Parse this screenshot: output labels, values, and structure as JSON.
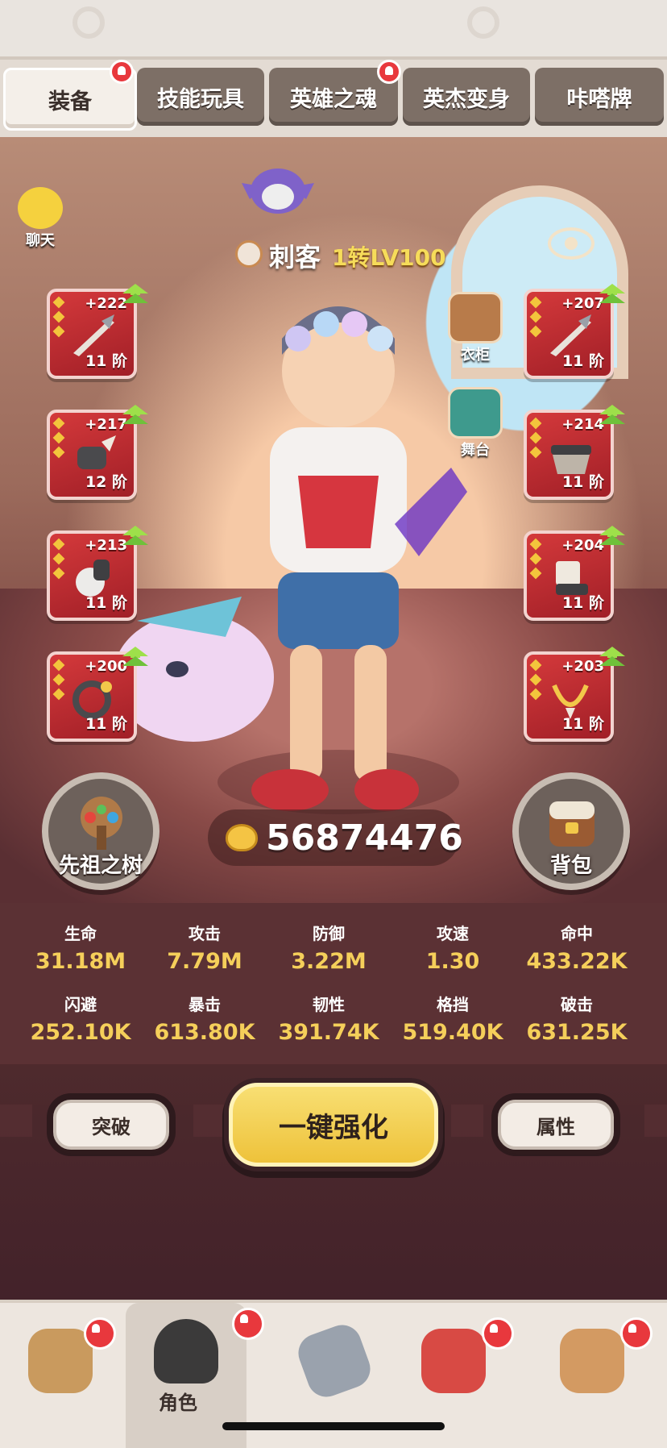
{
  "tabs": [
    {
      "label": "装备",
      "active": true,
      "badge": true
    },
    {
      "label": "技能玩具",
      "active": false,
      "badge": false
    },
    {
      "label": "英雄之魂",
      "active": false,
      "badge": true
    },
    {
      "label": "英杰变身",
      "active": false,
      "badge": false
    },
    {
      "label": "咔嗒牌",
      "active": false,
      "badge": false
    }
  ],
  "chat": {
    "label": "聊天"
  },
  "hero": {
    "class_name": "刺客",
    "level": "1转LV100"
  },
  "side_shortcuts": {
    "wardrobe": "衣柜",
    "stage": "舞台"
  },
  "equipment_left": [
    {
      "plus": "+222",
      "tier": "11 阶"
    },
    {
      "plus": "+217",
      "tier": "12 阶"
    },
    {
      "plus": "+213",
      "tier": "11 阶"
    },
    {
      "plus": "+200",
      "tier": "11 阶"
    }
  ],
  "equipment_right": [
    {
      "plus": "+207",
      "tier": "11 阶"
    },
    {
      "plus": "+214",
      "tier": "11 阶"
    },
    {
      "plus": "+204",
      "tier": "11 阶"
    },
    {
      "plus": "+203",
      "tier": "11 阶"
    }
  ],
  "ancestor_tree": {
    "label": "先祖之树"
  },
  "backpack": {
    "label": "背包"
  },
  "gold": {
    "value": "56874476"
  },
  "stats": [
    {
      "label": "生命",
      "value": "31.18M"
    },
    {
      "label": "攻击",
      "value": "7.79M"
    },
    {
      "label": "防御",
      "value": "3.22M"
    },
    {
      "label": "攻速",
      "value": "1.30"
    },
    {
      "label": "命中",
      "value": "433.22K"
    },
    {
      "label": "闪避",
      "value": "252.10K"
    },
    {
      "label": "暴击",
      "value": "613.80K"
    },
    {
      "label": "韧性",
      "value": "391.74K"
    },
    {
      "label": "格挡",
      "value": "519.40K"
    },
    {
      "label": "破击",
      "value": "631.25K"
    }
  ],
  "actions": {
    "breakthrough": "突破",
    "one_click": "一键强化",
    "attributes": "属性"
  },
  "bottom_nav": [
    {
      "name": "nav-hut",
      "label": "",
      "badge": true
    },
    {
      "name": "nav-character",
      "label": "角色",
      "badge": true,
      "active": true
    },
    {
      "name": "nav-weapon",
      "label": "",
      "badge": false
    },
    {
      "name": "nav-pet",
      "label": "",
      "badge": true
    },
    {
      "name": "nav-tribe",
      "label": "",
      "badge": true
    }
  ],
  "colors": {
    "accent_gold": "#f5cf5a",
    "slot_red": "#c22c30",
    "main_button": "#f3cf4f",
    "badge_red": "#e8383d"
  }
}
